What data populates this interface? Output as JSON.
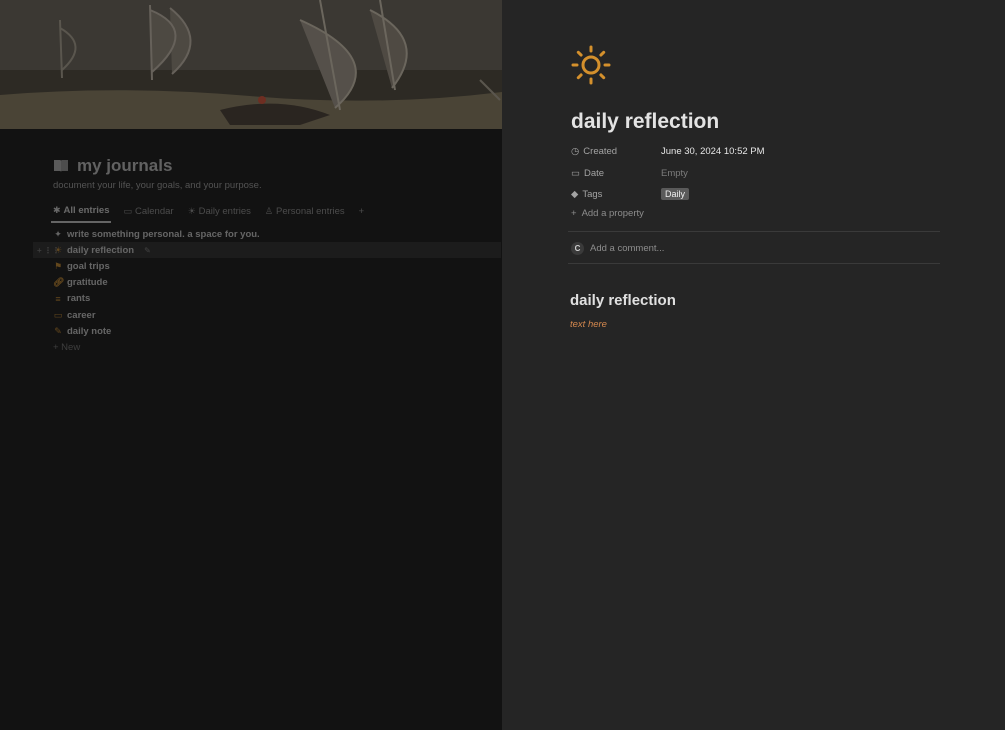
{
  "database": {
    "title": "my journals",
    "description": "document your life, your goals, and your purpose.",
    "tabs": [
      {
        "label": "All entries",
        "icon": "asterisk-icon",
        "active": true
      },
      {
        "label": "Calendar",
        "icon": "calendar-icon"
      },
      {
        "label": "Daily entries",
        "icon": "sun-icon"
      },
      {
        "label": "Personal entries",
        "icon": "person-icon"
      }
    ],
    "add_view": "+",
    "rows": [
      {
        "label": "write something personal. a space for you.",
        "icon": "diamond-icon"
      },
      {
        "label": "daily reflection",
        "icon": "sun-icon"
      },
      {
        "label": "goal trips",
        "icon": "flag-icon"
      },
      {
        "label": "gratitude",
        "icon": "link-icon"
      },
      {
        "label": "rants",
        "icon": "lines-icon"
      },
      {
        "label": "career",
        "icon": "briefcase-icon"
      },
      {
        "label": "daily note",
        "icon": "pencil-icon"
      }
    ],
    "new_label": "+ New"
  },
  "panel": {
    "icon": "sun-icon",
    "icon_color": "#d4902c",
    "title": "daily reflection",
    "properties": {
      "created": {
        "name": "Created",
        "value": "June 30, 2024 10:52 PM"
      },
      "date": {
        "name": "Date",
        "value": "Empty"
      },
      "tags": {
        "name": "Tags",
        "value": "Daily"
      }
    },
    "add_property": "Add a property",
    "comment": {
      "avatar_initial": "C",
      "placeholder": "Add a comment..."
    },
    "heading": "daily reflection",
    "body_text": "text here",
    "body_text_color": "#d4884e"
  }
}
